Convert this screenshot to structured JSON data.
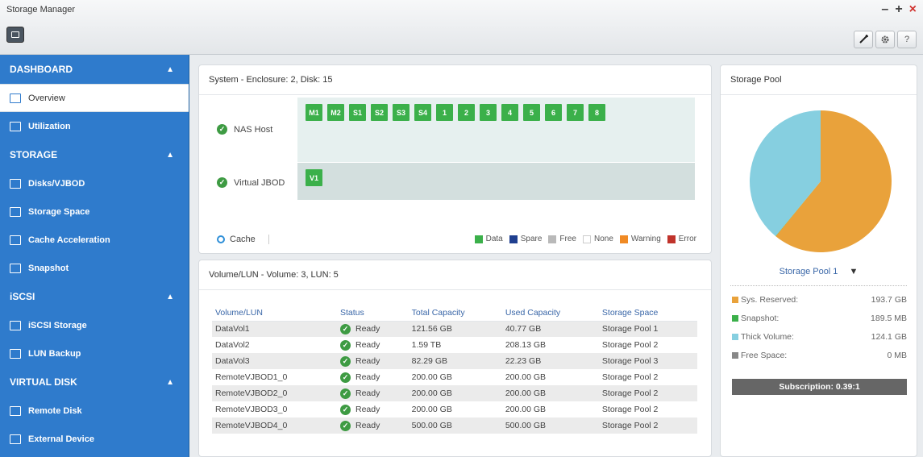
{
  "window": {
    "title": "Storage Manager",
    "controls": [
      "–",
      "+",
      "×"
    ]
  },
  "toolbar": {
    "buttons": [
      "tool-icon",
      "gear-icon",
      "?"
    ]
  },
  "sidebar": {
    "sections": [
      {
        "label": "DASHBOARD",
        "items": [
          {
            "label": "Overview",
            "active": true
          },
          {
            "label": "Utilization"
          }
        ]
      },
      {
        "label": "STORAGE",
        "items": [
          {
            "label": "Disks/VJBOD"
          },
          {
            "label": "Storage Space"
          },
          {
            "label": "Cache Acceleration"
          },
          {
            "label": "Snapshot"
          }
        ]
      },
      {
        "label": "iSCSI",
        "items": [
          {
            "label": "iSCSI Storage"
          },
          {
            "label": "LUN Backup"
          }
        ]
      },
      {
        "label": "VIRTUAL DISK",
        "items": [
          {
            "label": "Remote Disk"
          },
          {
            "label": "External Device"
          }
        ]
      }
    ]
  },
  "system": {
    "title": "System - Enclosure: 2, Disk: 15",
    "nas_host": {
      "label": "NAS Host",
      "disks": [
        "M1",
        "M2",
        "S1",
        "S2",
        "S3",
        "S4",
        "1",
        "2",
        "3",
        "4",
        "5",
        "6",
        "7",
        "8"
      ]
    },
    "virtual_jbod": {
      "label": "Virtual JBOD",
      "disks": [
        "V1"
      ]
    },
    "cache_label": "Cache",
    "legend": [
      {
        "label": "Data",
        "color": "#3bb04a"
      },
      {
        "label": "Spare",
        "color": "#1f3f8f"
      },
      {
        "label": "Free",
        "color": "#b9b9b9"
      },
      {
        "label": "None",
        "color": "#ffffff"
      },
      {
        "label": "Warning",
        "color": "#f08a24"
      },
      {
        "label": "Error",
        "color": "#c0332b"
      }
    ]
  },
  "volumes": {
    "title": "Volume/LUN - Volume: 3, LUN: 5",
    "columns": [
      "Volume/LUN",
      "Status",
      "Total Capacity",
      "Used Capacity",
      "Storage Space"
    ],
    "rows": [
      [
        "DataVol1",
        "Ready",
        "121.56 GB",
        "40.77 GB",
        "Storage Pool 1"
      ],
      [
        "DataVol2",
        "Ready",
        "1.59 TB",
        "208.13 GB",
        "Storage Pool 2"
      ],
      [
        "DataVol3",
        "Ready",
        "82.29 GB",
        "22.23 GB",
        "Storage Pool 3"
      ],
      [
        "RemoteVJBOD1_0",
        "Ready",
        "200.00 GB",
        "200.00 GB",
        "Storage Pool 2"
      ],
      [
        "RemoteVJBOD2_0",
        "Ready",
        "200.00 GB",
        "200.00 GB",
        "Storage Pool 2"
      ],
      [
        "RemoteVJBOD3_0",
        "Ready",
        "200.00 GB",
        "200.00 GB",
        "Storage Pool 2"
      ],
      [
        "RemoteVJBOD4_0",
        "Ready",
        "500.00 GB",
        "500.00 GB",
        "Storage Pool 2"
      ]
    ]
  },
  "pool": {
    "title": "Storage Pool",
    "selected": "Storage Pool 1",
    "stats": [
      {
        "label": "Sys. Reserved:",
        "value": "193.7 GB",
        "color": "#e9a23b"
      },
      {
        "label": "Snapshot:",
        "value": "189.5 MB",
        "color": "#3bb04a"
      },
      {
        "label": "Thick Volume:",
        "value": "124.1 GB",
        "color": "#86cfe0"
      },
      {
        "label": "Free Space:",
        "value": "0 MB",
        "color": "#888888"
      }
    ],
    "subscription": "Subscription: 0.39:1"
  },
  "chart_data": {
    "type": "pie",
    "slices": [
      {
        "name": "Sys. Reserved",
        "value": 193.7,
        "color": "#e9a23b"
      },
      {
        "name": "Snapshot",
        "value": 0.19,
        "color": "#3bb04a"
      },
      {
        "name": "Thick Volume",
        "value": 124.1,
        "color": "#86cfe0"
      },
      {
        "name": "Free Space",
        "value": 0,
        "color": "#888888"
      }
    ]
  }
}
